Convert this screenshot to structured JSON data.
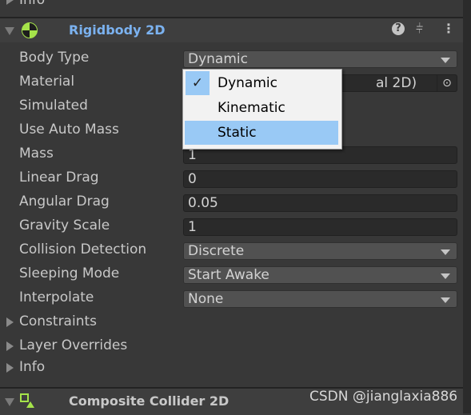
{
  "top_prev": {
    "label": "Info"
  },
  "rigidbody": {
    "title": "Rigidbody 2D",
    "fields": [
      {
        "label": "Body Type",
        "value": "Dynamic",
        "kind": "dropdown"
      },
      {
        "label": "Material",
        "value": "al 2D)",
        "kind": "object"
      },
      {
        "label": "Simulated",
        "value": "",
        "kind": "checkbox"
      },
      {
        "label": "Use Auto Mass",
        "value": "",
        "kind": "checkbox"
      },
      {
        "label": "Mass",
        "value": "1",
        "kind": "text"
      },
      {
        "label": "Linear Drag",
        "value": "0",
        "kind": "text"
      },
      {
        "label": "Angular Drag",
        "value": "0.05",
        "kind": "text"
      },
      {
        "label": "Gravity Scale",
        "value": "1",
        "kind": "text"
      },
      {
        "label": "Collision Detection",
        "value": "Discrete",
        "kind": "dropdown"
      },
      {
        "label": "Sleeping Mode",
        "value": "Start Awake",
        "kind": "dropdown"
      },
      {
        "label": "Interpolate",
        "value": "None",
        "kind": "dropdown"
      }
    ],
    "foldouts": [
      "Constraints",
      "Layer Overrides",
      "Info"
    ]
  },
  "body_type_menu": {
    "options": [
      "Dynamic",
      "Kinematic",
      "Static"
    ],
    "selected": "Dynamic",
    "hovered": "Static"
  },
  "composite": {
    "title": "Composite Collider 2D"
  },
  "watermark": "CSDN @jianglaxia886",
  "colors": {
    "title_active": "#7bb2f0",
    "icon_green": "#a5e34a",
    "menu_highlight": "#99c9f5"
  }
}
